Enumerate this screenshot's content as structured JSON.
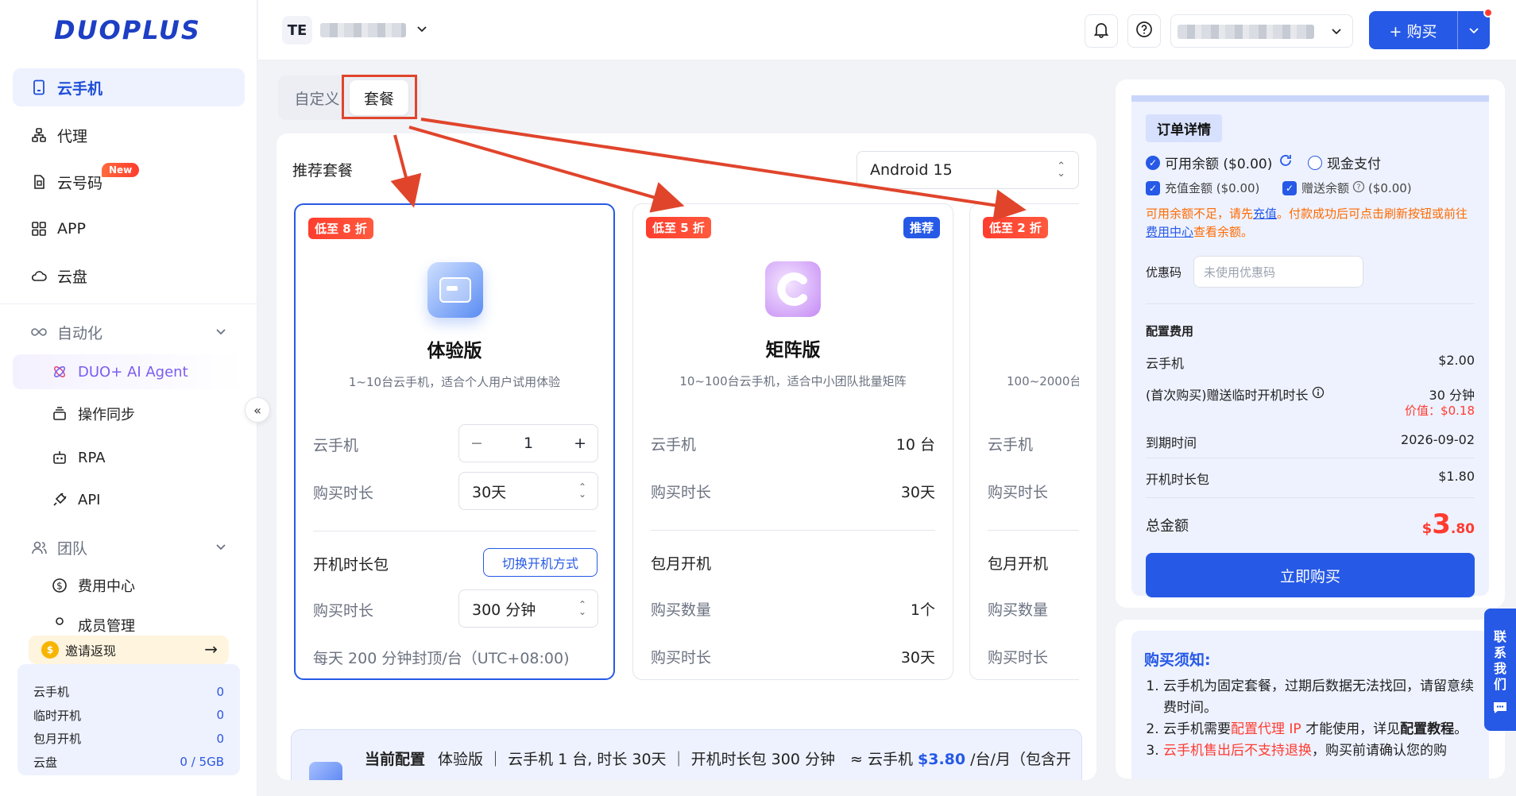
{
  "brand": {
    "logo_text": "DUOPLUS"
  },
  "sidebar": {
    "items": [
      {
        "label": "云手机",
        "icon": "phone-icon",
        "active": true
      },
      {
        "label": "代理",
        "icon": "proxy-icon"
      },
      {
        "label": "云号码",
        "icon": "sim-icon",
        "badge": "New"
      },
      {
        "label": "APP",
        "icon": "apps-grid-icon"
      },
      {
        "label": "云盘",
        "icon": "cloud-icon"
      }
    ],
    "automation": {
      "label": "自动化",
      "items": [
        {
          "label": "DUO+ AI Agent",
          "icon": "ai-agent-icon"
        },
        {
          "label": "操作同步",
          "icon": "sync-icon"
        },
        {
          "label": "RPA",
          "icon": "robot-icon"
        },
        {
          "label": "API",
          "icon": "plug-icon"
        }
      ]
    },
    "team": {
      "label": "团队",
      "items": [
        {
          "label": "费用中心",
          "icon": "dollar-icon"
        },
        {
          "label": "成员管理",
          "icon": "member-icon"
        }
      ]
    },
    "invite": {
      "label": "邀请返现",
      "arrow": "→"
    },
    "stats": [
      {
        "label": "云手机",
        "value": "0"
      },
      {
        "label": "临时开机",
        "value": "0"
      },
      {
        "label": "包月开机",
        "value": "0"
      },
      {
        "label": "云盘",
        "value": "0 / 5GB"
      }
    ]
  },
  "topbar": {
    "workspace_initials": "TE",
    "buy_label": "+ 购买"
  },
  "tabs": [
    {
      "label": "自定义"
    },
    {
      "label": "套餐",
      "selected": true
    }
  ],
  "packages": {
    "title": "推荐套餐",
    "os_select": "Android 15",
    "cards": [
      {
        "discount": "低至 8 折",
        "name": "体验版",
        "desc": "1~10台云手机，适合个人用户试用体验",
        "phone_label": "云手机",
        "phone_value": "1",
        "duration_label": "购买时长",
        "duration_value": "30天",
        "pack_label": "开机时长包",
        "switch_label": "切换开机方式",
        "pack_duration_label": "购买时长",
        "pack_duration_value": "300 分钟",
        "daily_note": "每天 200 分钟封顶/台（UTC+08:00)"
      },
      {
        "discount": "低至 5 折",
        "recommend": "推荐",
        "name": "矩阵版",
        "desc": "10~100台云手机，适合中小团队批量矩阵",
        "phone_label": "云手机",
        "phone_value": "10 台",
        "duration_label": "购买时长",
        "duration_value": "30天",
        "pack_label": "包月开机",
        "qty_label": "购买数量",
        "qty_value": "1个",
        "pack_duration_label": "购买时长",
        "pack_duration_value": "30天"
      },
      {
        "discount": "低至 2 折",
        "desc": "100~2000台",
        "phone_label": "云手机",
        "duration_label": "购买时长",
        "pack_label": "包月开机",
        "qty_label": "购买数量",
        "pack_duration_label": "购买时长"
      }
    ],
    "current": {
      "title": "当前配置",
      "text": "体验版 ｜ 云手机 1 台, 时长 30天 ｜ 开机时长包 300 分钟",
      "approx": "≈ 云手机",
      "price": "$3.80",
      "unit": "/台/月（包含开"
    }
  },
  "order": {
    "title": "订单详情",
    "balance_label": "可用余额 ($0.00)",
    "cash_label": "现金支付",
    "recharge_label": "充值金额 ($0.00)",
    "gift_label": "赠送余额",
    "gift_value": "($0.00)",
    "warn_1": "可用余额不足，请先",
    "warn_link_1": "充值",
    "warn_2": "。付款成功后可点击刷新按钮或前往",
    "warn_link_2": "费用中心",
    "warn_3": "查看余额。",
    "coupon_label": "优惠码",
    "coupon_placeholder": "未使用优惠码",
    "fees_title": "配置费用",
    "phone_label": "云手机",
    "phone_value": "$2.00",
    "gift_time_label": "(首次购买)赠送临时开机时长",
    "gift_time_value": "30 分钟",
    "gift_time_price": "价值：$0.18",
    "expire_label": "到期时间",
    "expire_value": "2026-09-02",
    "pack_label": "开机时长包",
    "pack_value": "$1.80",
    "total_label": "总金额",
    "total_currency": "$",
    "total_int": "3",
    "total_dec": ".80",
    "buy_now": "立即购买"
  },
  "notice": {
    "title": "购买须知:",
    "items": [
      {
        "parts": [
          {
            "t": "云手机为固定套餐，过期后数据无法找回，请留意续费时间。"
          }
        ]
      },
      {
        "parts": [
          {
            "t": "云手机需要"
          },
          {
            "t": "配置代理 IP",
            "c": "r"
          },
          {
            "t": " 才能使用，详见"
          },
          {
            "t": "配置教程",
            "c": "b"
          },
          {
            "t": "。"
          }
        ]
      },
      {
        "parts": [
          {
            "t": "云手机售出后不支持退换",
            "c": "r"
          },
          {
            "t": "，购买前请确认您的购"
          }
        ]
      }
    ]
  },
  "contact": {
    "label": "联系我们"
  },
  "colors": {
    "primary": "#2659e6",
    "danger": "#ff3b30",
    "annotation": "#e0452c"
  }
}
